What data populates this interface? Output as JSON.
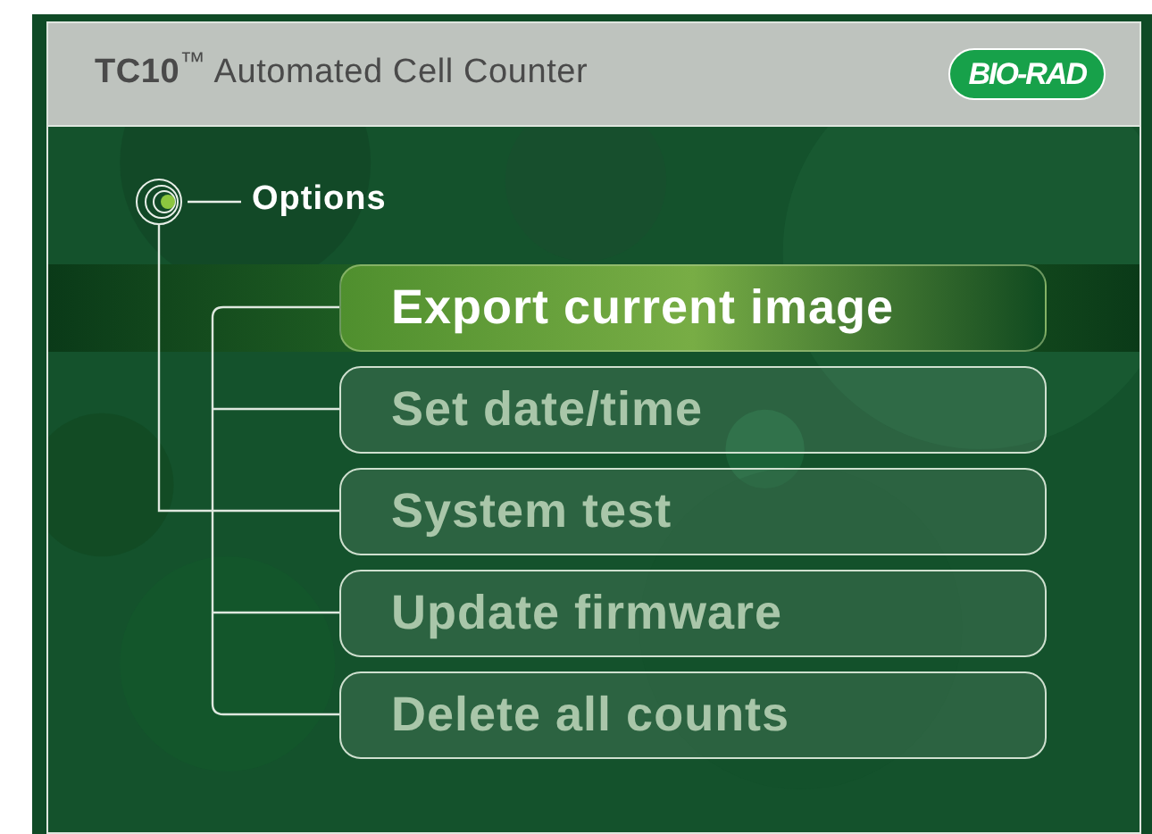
{
  "header": {
    "title": "**TC10**$^{™}$ Automated Cell Counter",
    "logo": "BIO-RAD"
  },
  "menu": {
    "title": "Options",
    "items": [
      {
        "label": "Export current image",
        "selected": true
      },
      {
        "label": "Set date/time",
        "selected": false
      },
      {
        "label": "System test",
        "selected": false
      },
      {
        "label": "Update firmware",
        "selected": false
      },
      {
        "label": "Delete all counts",
        "selected": false
      }
    ]
  }
}
